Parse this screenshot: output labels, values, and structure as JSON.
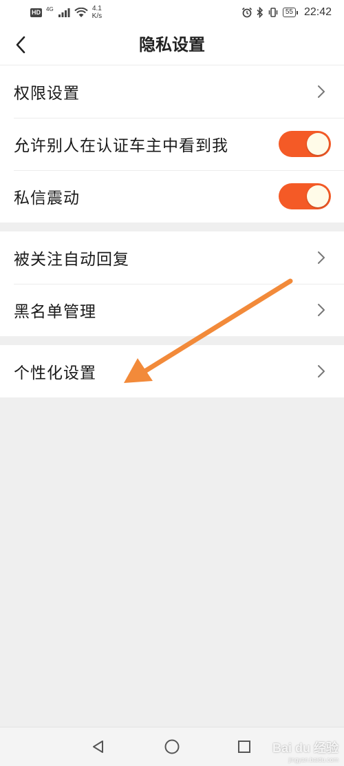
{
  "status_bar": {
    "hd": "HD",
    "network": "4G",
    "speed_value": "4.1",
    "speed_unit": "K/s",
    "battery": "55",
    "time": "22:42"
  },
  "header": {
    "title": "隐私设置",
    "back_icon": "chevron-left-icon"
  },
  "groups": [
    {
      "items": [
        {
          "label": "权限设置",
          "control": "chevron"
        },
        {
          "label": "允许别人在认证车主中看到我",
          "control": "toggle",
          "on": true
        },
        {
          "label": "私信震动",
          "control": "toggle",
          "on": true
        }
      ]
    },
    {
      "items": [
        {
          "label": "被关注自动回复",
          "control": "chevron"
        },
        {
          "label": "黑名单管理",
          "control": "chevron"
        }
      ]
    },
    {
      "items": [
        {
          "label": "个性化设置",
          "control": "chevron"
        }
      ]
    }
  ],
  "colors": {
    "toggle_on": "#f45a26",
    "annotation_arrow": "#f28a3a"
  },
  "watermark": {
    "brand": "Bai du 经验",
    "url": "jingyan.baidu.com"
  }
}
